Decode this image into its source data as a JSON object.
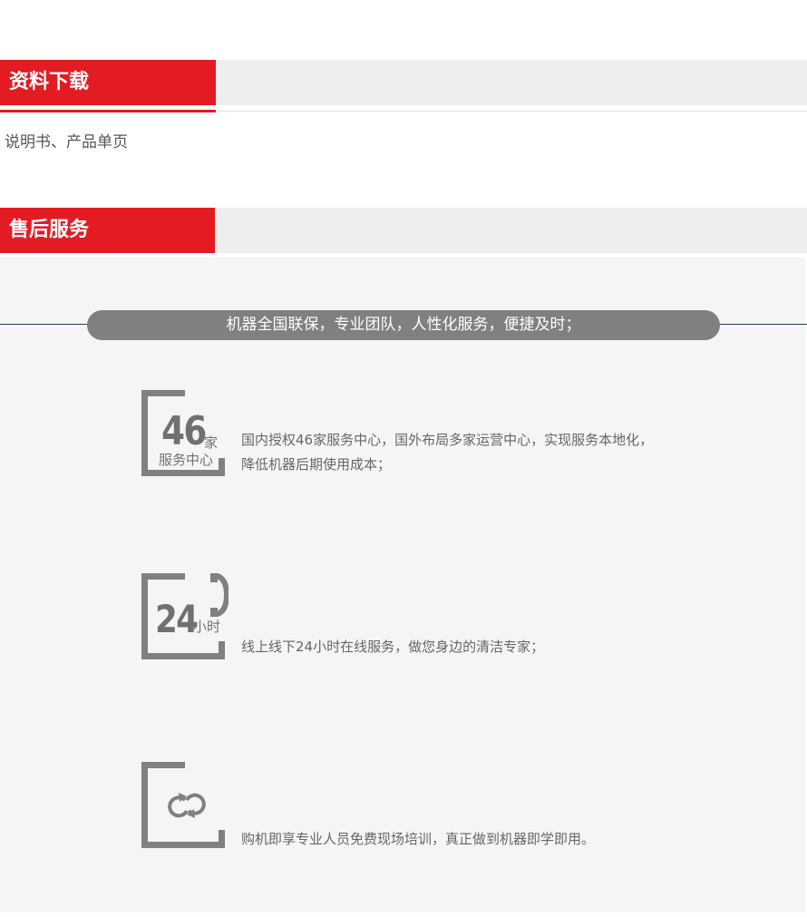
{
  "download": {
    "title": "资料下载",
    "content": "说明书、产品单页"
  },
  "service": {
    "title": "售后服务",
    "banner": "机器全国联保，专业团队，人性化服务，便捷及时；",
    "features": [
      {
        "number": "46",
        "unit": "家",
        "label": "服务中心",
        "lines": [
          "国内授权46家服务中心，国外布局多家运营中心，实现服务本地化，",
          "降低机器后期使用成本；"
        ],
        "icon": "service-center-icon"
      },
      {
        "number": "24",
        "unit": "小时",
        "label": "",
        "lines": [
          "线上线下24小时在线服务，做您身边的清洁专家；"
        ],
        "icon": "phone-icon"
      },
      {
        "number": "",
        "unit": "",
        "label": "",
        "lines": [
          "购机即享专业人员免费现场培训，真正做到机器即学即用。"
        ],
        "icon": "refresh-cycle-icon"
      }
    ]
  },
  "colors": {
    "accent": "#e31b23",
    "header_bg": "#eeeeee",
    "panel_bg": "#f5f5f5",
    "pill_bg": "#808080"
  }
}
